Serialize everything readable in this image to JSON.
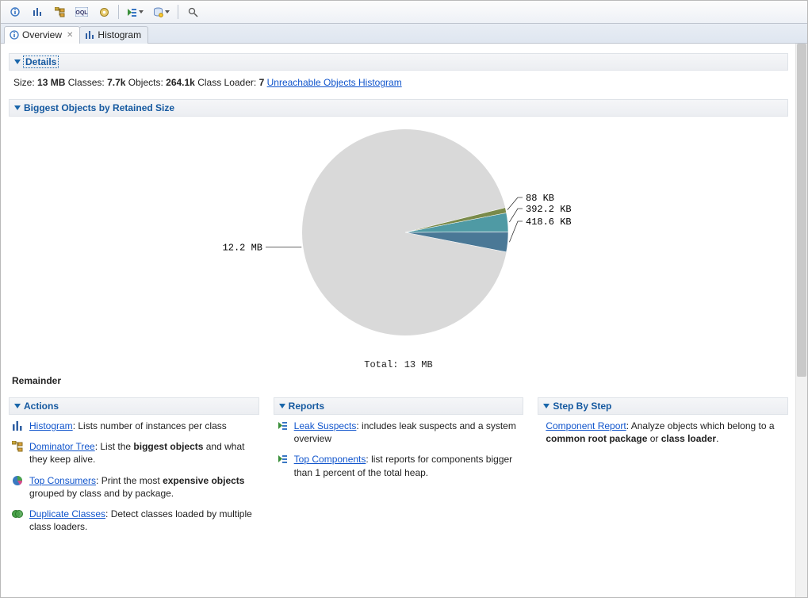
{
  "toolbar": {
    "icons": [
      "info-icon",
      "histogram-icon",
      "tree-icon",
      "oql-icon",
      "gear-icon",
      "run-query-icon",
      "query-browser-icon",
      "search-icon"
    ]
  },
  "tabs": {
    "overview": "Overview",
    "histogram": "Histogram"
  },
  "sections": {
    "details_title": "Details",
    "biggest_title": "Biggest Objects by Retained Size",
    "actions_title": "Actions",
    "reports_title": "Reports",
    "step_title": "Step By Step"
  },
  "details": {
    "size_label": "Size:",
    "size_value": "13 MB",
    "classes_label": "Classes:",
    "classes_value": "7.7k",
    "objects_label": "Objects:",
    "objects_value": "264.1k",
    "classloader_label": "Class Loader:",
    "classloader_value": "7",
    "unreachable_link": "Unreachable Objects Histogram"
  },
  "chart_data": {
    "type": "pie",
    "title": "",
    "total_label": "Total: 13 MB",
    "slices": [
      {
        "label": "12.2 MB",
        "value_kb": 12492.8,
        "color": "#d9d9d9"
      },
      {
        "label": "418.6 KB",
        "value_kb": 418.6,
        "color": "#4a7896"
      },
      {
        "label": "392.2 KB",
        "value_kb": 392.2,
        "color": "#4f9aa4"
      },
      {
        "label": "88 KB",
        "value_kb": 88.0,
        "color": "#7a8a4a"
      }
    ],
    "remainder_label": "Remainder"
  },
  "actions": [
    {
      "link": "Histogram",
      "rest": ": Lists number of instances per class",
      "icon": "histogram-icon"
    },
    {
      "link": "Dominator Tree",
      "rest": ": List the ",
      "bold": "biggest objects",
      "rest2": " and what they keep alive.",
      "icon": "tree-icon"
    },
    {
      "link": "Top Consumers",
      "rest": ": Print the most ",
      "bold": "expensive objects",
      "rest2": " grouped by class and by package.",
      "icon": "pie-icon"
    },
    {
      "link": "Duplicate Classes",
      "rest": ": Detect classes loaded by multiple class loaders.",
      "icon": "duplicate-icon"
    }
  ],
  "reports": [
    {
      "link": "Leak Suspects",
      "rest": ": includes leak suspects and a system overview",
      "icon": "report-icon"
    },
    {
      "link": "Top Components",
      "rest": ": list reports for components bigger than 1 percent of the total heap.",
      "icon": "report-icon"
    }
  ],
  "steps": [
    {
      "link": "Component Report",
      "rest": ": Analyze objects which belong to a ",
      "bold": "common root package",
      "rest2": " or ",
      "bold2": "class loader",
      "rest3": "."
    }
  ]
}
